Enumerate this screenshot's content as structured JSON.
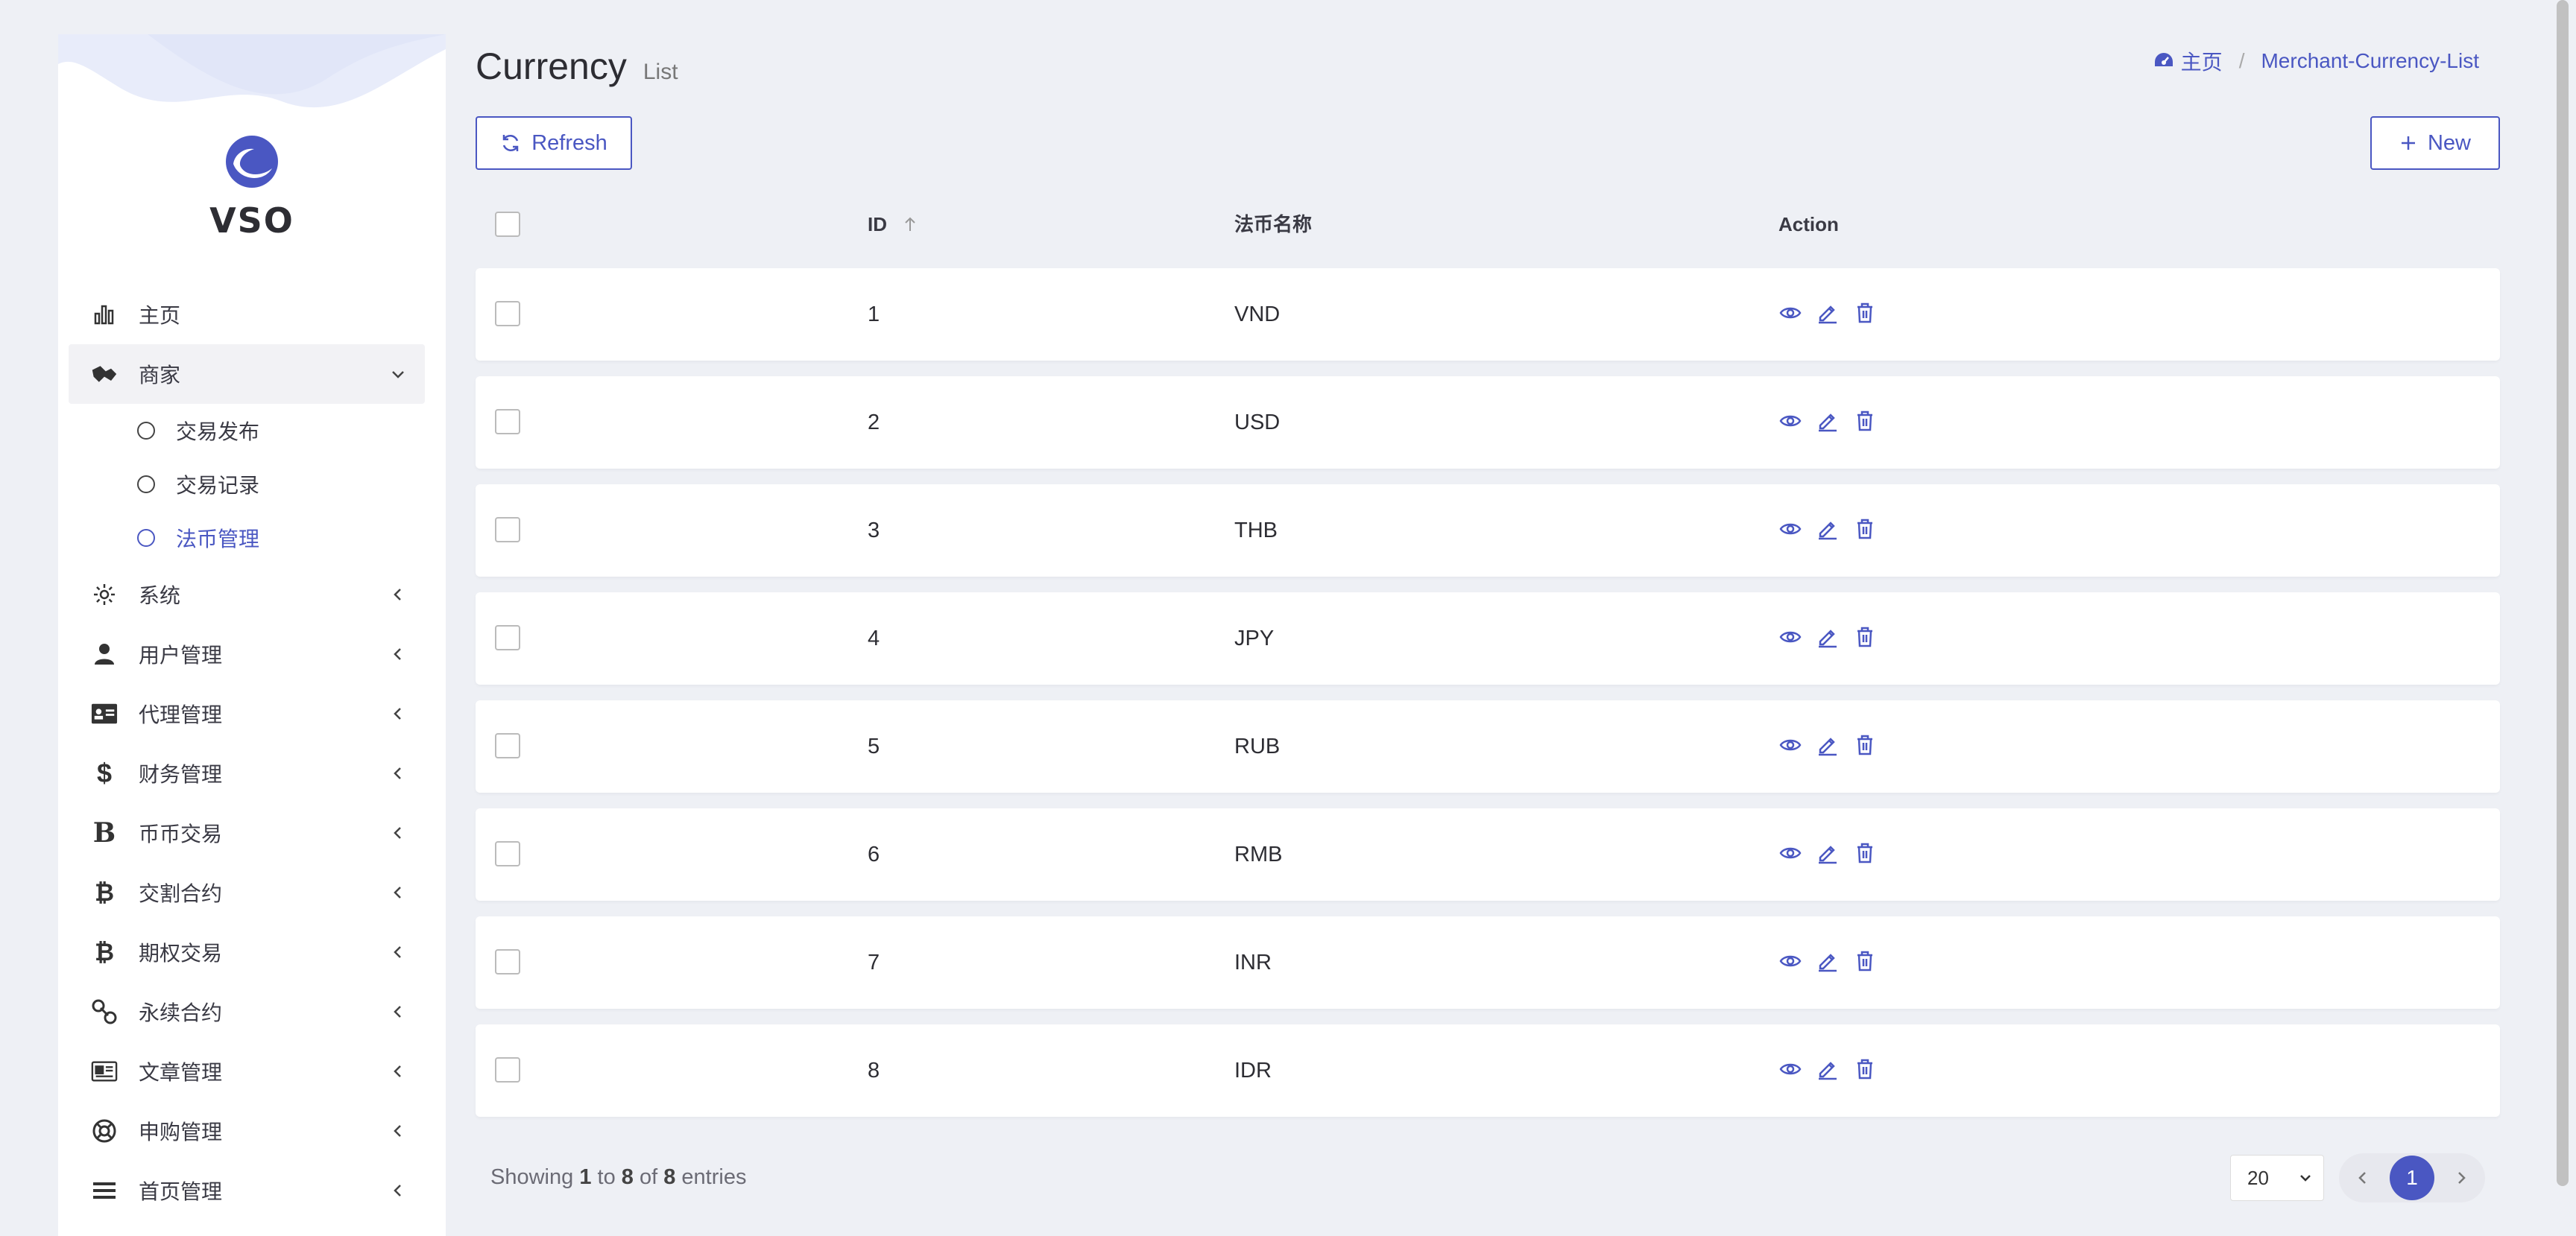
{
  "brand": {
    "name": "VSO"
  },
  "sidebar": {
    "items": [
      {
        "label": "主页",
        "icon": "bar-chart-icon",
        "expandable": false
      },
      {
        "label": "商家",
        "icon": "merchant-icon",
        "expandable": true,
        "expanded": true,
        "children": [
          {
            "label": "交易发布",
            "current": false
          },
          {
            "label": "交易记录",
            "current": false
          },
          {
            "label": "法币管理",
            "current": true
          }
        ]
      },
      {
        "label": "系统",
        "icon": "gear-icon",
        "expandable": true
      },
      {
        "label": "用户管理",
        "icon": "user-icon",
        "expandable": true
      },
      {
        "label": "代理管理",
        "icon": "id-card-icon",
        "expandable": true
      },
      {
        "label": "财务管理",
        "icon": "dollar-icon",
        "expandable": true
      },
      {
        "label": "币币交易",
        "icon": "b-letter-icon",
        "expandable": true
      },
      {
        "label": "交割合约",
        "icon": "bitcoin-icon",
        "expandable": true
      },
      {
        "label": "期权交易",
        "icon": "bitcoin-icon",
        "expandable": true
      },
      {
        "label": "永续合约",
        "icon": "link-icon",
        "expandable": true
      },
      {
        "label": "文章管理",
        "icon": "newspaper-icon",
        "expandable": true
      },
      {
        "label": "申购管理",
        "icon": "life-ring-icon",
        "expandable": true
      },
      {
        "label": "首页管理",
        "icon": "list-icon",
        "expandable": true
      }
    ]
  },
  "header": {
    "title": "Currency",
    "subtitle": "List",
    "breadcrumb": {
      "home": "主页",
      "current": "Merchant-Currency-List"
    }
  },
  "toolbar": {
    "refresh_label": "Refresh",
    "new_label": "New"
  },
  "table": {
    "columns": [
      "ID",
      "法币名称",
      "Action"
    ],
    "rows": [
      {
        "id": "1",
        "name": "VND"
      },
      {
        "id": "2",
        "name": "USD"
      },
      {
        "id": "3",
        "name": "THB"
      },
      {
        "id": "4",
        "name": "JPY"
      },
      {
        "id": "5",
        "name": "RUB"
      },
      {
        "id": "6",
        "name": "RMB"
      },
      {
        "id": "7",
        "name": "INR"
      },
      {
        "id": "8",
        "name": "IDR"
      }
    ]
  },
  "footer": {
    "showing_prefix": "Showing",
    "from": "1",
    "to_word": "to",
    "to": "8",
    "of_word": "of",
    "total": "8",
    "suffix": "entries",
    "page_size": "20",
    "current_page": "1"
  },
  "colors": {
    "accent": "#4a57c2",
    "background": "#eef0f5"
  }
}
